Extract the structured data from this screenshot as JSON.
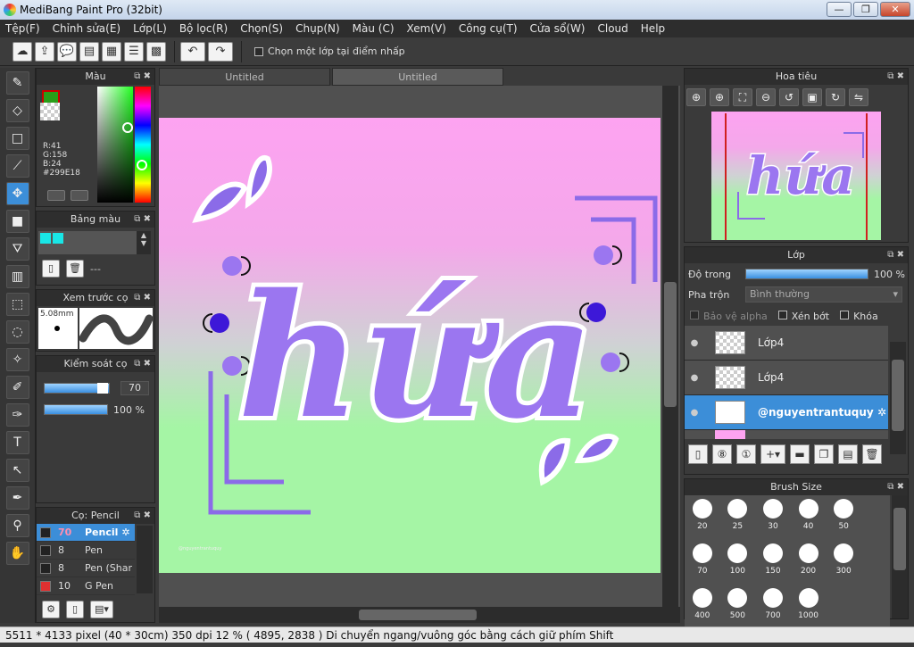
{
  "window": {
    "title": "MediBang Paint Pro (32bit)"
  },
  "menu": [
    "Tệp(F)",
    "Chỉnh sửa(E)",
    "Lớp(L)",
    "Bộ lọc(R)",
    "Chọn(S)",
    "Chụp(N)",
    "Màu (C)",
    "Xem(V)",
    "Công cụ(T)",
    "Cửa sổ(W)",
    "Cloud",
    "Help"
  ],
  "toolbar": {
    "pick_layer_label": "Chọn một lớp tại điểm nhấp"
  },
  "color_panel": {
    "title": "Màu",
    "r": "R:41",
    "g": "G:158",
    "b": "B:24",
    "hex": "#299E18",
    "fg_color": "#299e18"
  },
  "palette_panel": {
    "title": "Bảng màu",
    "dash": "---"
  },
  "brush_preview": {
    "title": "Xem trước cọ",
    "size": "5.08mm"
  },
  "brush_control": {
    "title": "Kiểm soát cọ",
    "size_value": "70",
    "opacity_value": "100 %"
  },
  "brush_list": {
    "title": "Cọ: Pencil",
    "items": [
      {
        "num": "70",
        "name": "Pencil",
        "color": "#222222"
      },
      {
        "num": "8",
        "name": "Pen",
        "color": "#222222"
      },
      {
        "num": "8",
        "name": "Pen (Sharp)",
        "color": "#222222"
      },
      {
        "num": "10",
        "name": "G Pen",
        "color": "#e03030"
      }
    ]
  },
  "tabs": [
    "Untitled",
    "Untitled"
  ],
  "canvas": {
    "text": "hứa",
    "watermark": "@nguyentrantuquy"
  },
  "navigator": {
    "title": "Hoa tiêu",
    "text": "hứa"
  },
  "layer_panel": {
    "title": "Lớp",
    "opacity_label": "Độ trong",
    "opacity_value": "100 %",
    "opacity_fraction": 1.0,
    "blend_label": "Pha trộn",
    "blend_value": "Bình thường",
    "protect_alpha": "Bảo vệ alpha",
    "clipping": "Xén bớt",
    "lock": "Khóa",
    "layers": [
      {
        "name": "Lớp4"
      },
      {
        "name": "Lớp4"
      },
      {
        "name": "@nguyentrantuquy"
      }
    ]
  },
  "brush_size": {
    "title": "Brush Size",
    "sizes": [
      "20",
      "25",
      "30",
      "40",
      "50",
      "70",
      "100",
      "150",
      "200",
      "300",
      "400",
      "500",
      "700",
      "1000"
    ]
  },
  "status": {
    "text": "5511 * 4133 pixel  (40 * 30cm)   350 dpi   12 %   ( 4895, 2838 )   Di chuyển ngang/vuông góc bằng cách giữ phím Shift"
  }
}
